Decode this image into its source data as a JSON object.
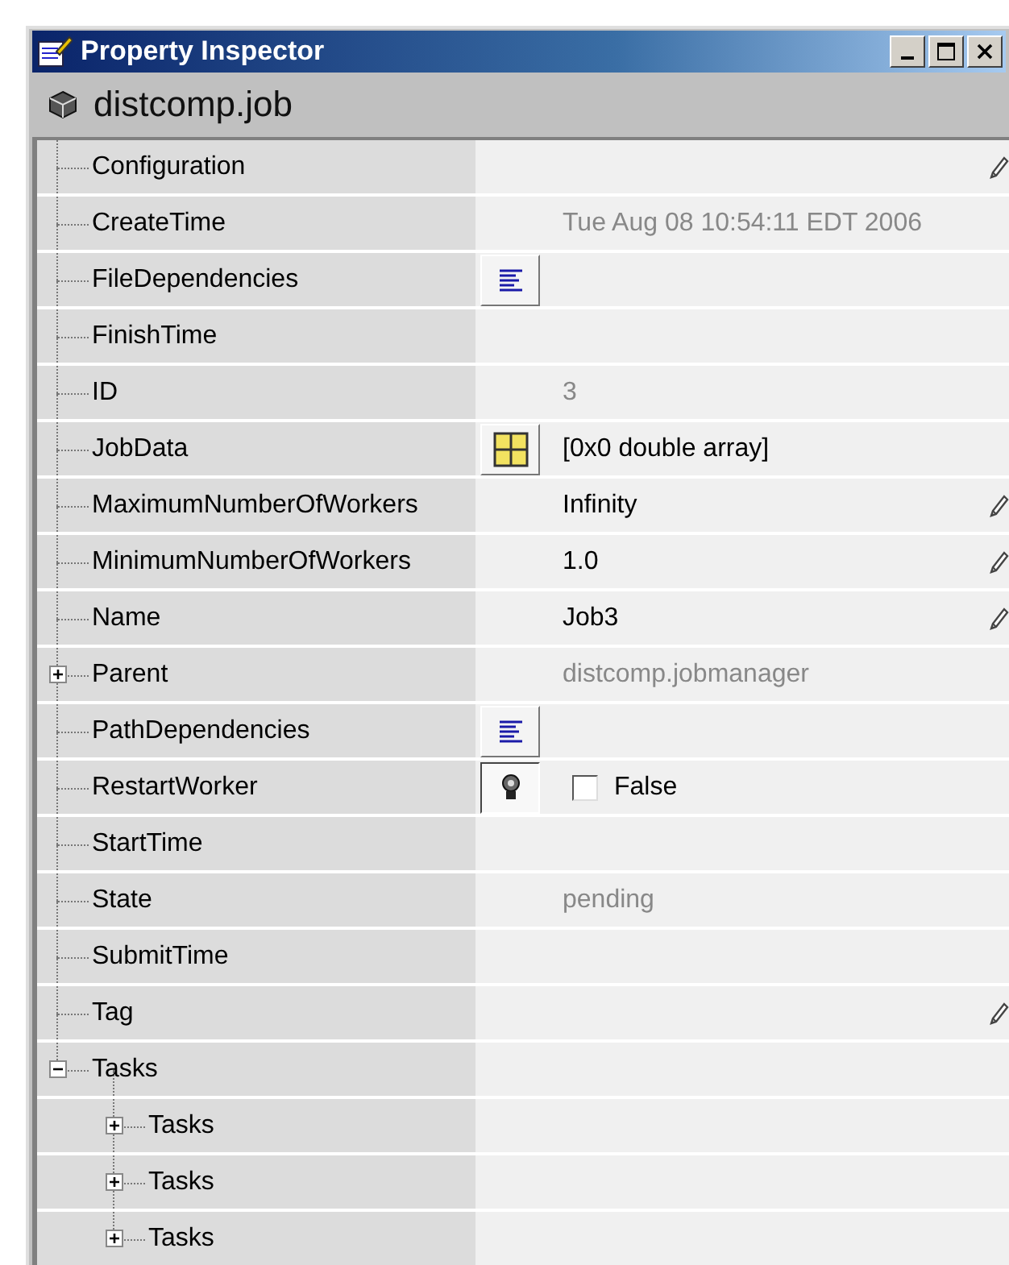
{
  "window": {
    "title": "Property Inspector"
  },
  "object": {
    "name": "distcomp.job"
  },
  "properties": [
    {
      "name": "Configuration",
      "editable": true
    },
    {
      "name": "CreateTime",
      "value": "Tue Aug 08 10:54:11 EDT 2006",
      "readonly": true
    },
    {
      "name": "FileDependencies",
      "kind": "list"
    },
    {
      "name": "FinishTime"
    },
    {
      "name": "ID",
      "value": "3",
      "readonly": true
    },
    {
      "name": "JobData",
      "kind": "array",
      "value": "[0x0  double array]"
    },
    {
      "name": "MaximumNumberOfWorkers",
      "value": "Infinity",
      "editable": true
    },
    {
      "name": "MinimumNumberOfWorkers",
      "value": "1.0",
      "editable": true
    },
    {
      "name": "Name",
      "value": "Job3",
      "editable": true
    },
    {
      "name": "Parent",
      "value": "distcomp.jobmanager",
      "readonly": true,
      "expanded": false
    },
    {
      "name": "PathDependencies",
      "kind": "list"
    },
    {
      "name": "RestartWorker",
      "kind": "toggle",
      "checkbox": {
        "checked": false,
        "label": "False"
      }
    },
    {
      "name": "StartTime"
    },
    {
      "name": "State",
      "value": "pending",
      "readonly": true
    },
    {
      "name": "SubmitTime"
    },
    {
      "name": "Tag",
      "editable": true
    },
    {
      "name": "Tasks",
      "expanded": true,
      "children": [
        {
          "name": "Tasks",
          "expanded": false
        },
        {
          "name": "Tasks",
          "expanded": false
        },
        {
          "name": "Tasks",
          "expanded": false
        }
      ]
    }
  ]
}
